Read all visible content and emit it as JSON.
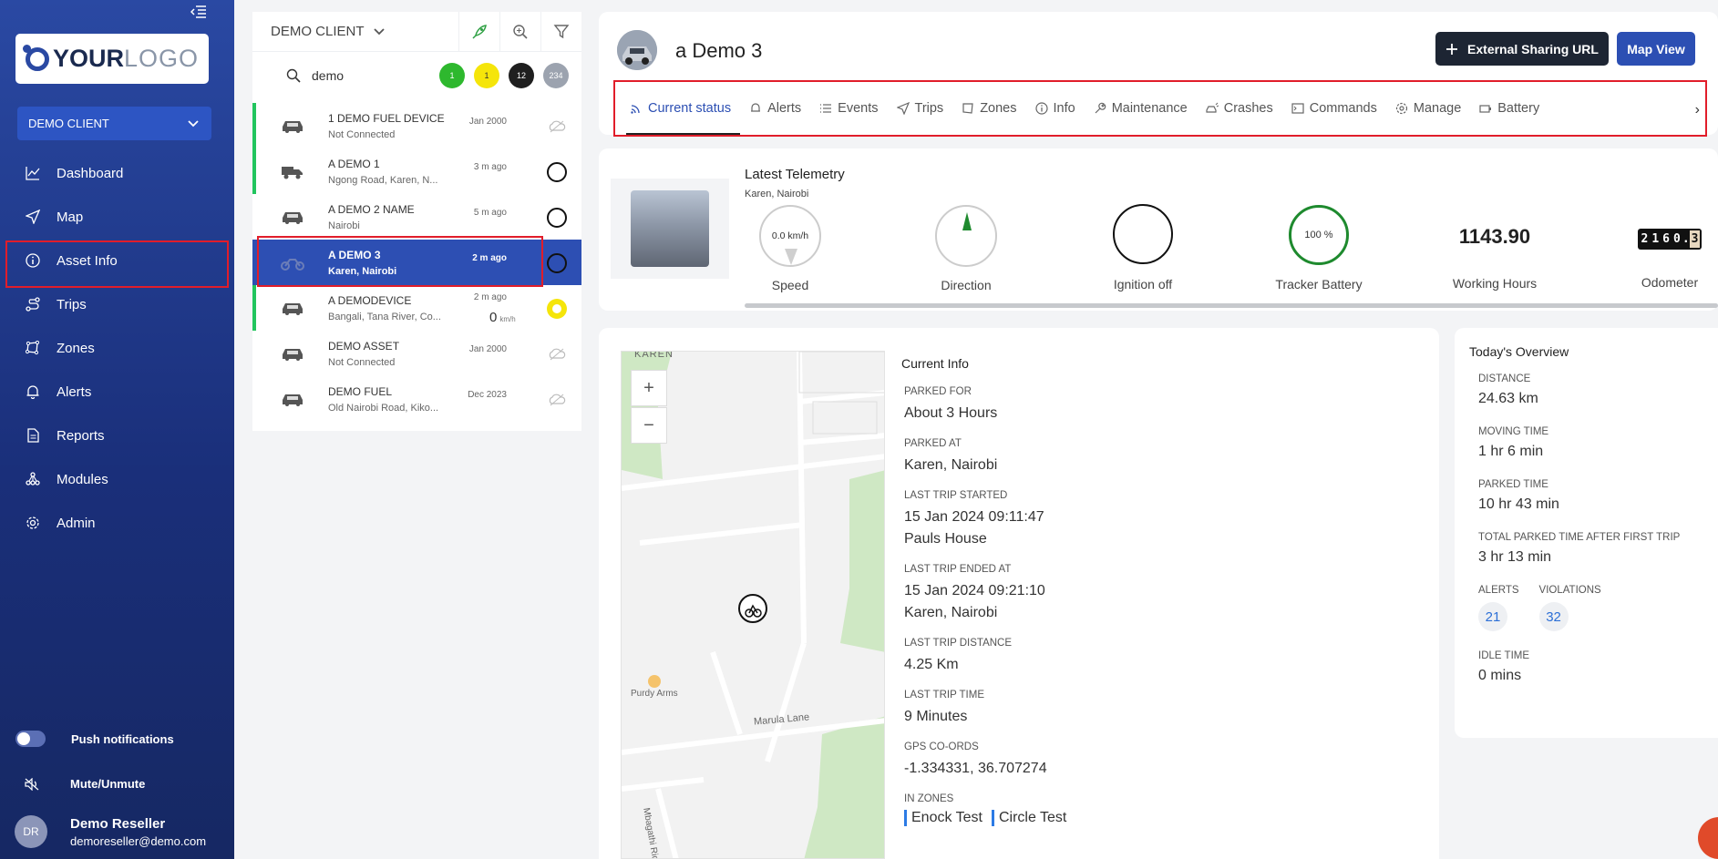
{
  "sidebar": {
    "logo_bold": "YOUR",
    "logo_light": "LOGO",
    "client_select": "DEMO CLIENT",
    "nav": [
      {
        "label": "Dashboard",
        "icon": "chart-line-icon"
      },
      {
        "label": "Map",
        "icon": "navigation-arrow-icon"
      },
      {
        "label": "Asset Info",
        "icon": "info-circle-icon"
      },
      {
        "label": "Trips",
        "icon": "route-icon"
      },
      {
        "label": "Zones",
        "icon": "zone-icon"
      },
      {
        "label": "Alerts",
        "icon": "bell-icon"
      },
      {
        "label": "Reports",
        "icon": "document-icon"
      },
      {
        "label": "Modules",
        "icon": "modules-icon"
      },
      {
        "label": "Admin",
        "icon": "gear-icon"
      }
    ],
    "push_label": "Push notifications",
    "mute_label": "Mute/Unmute",
    "user": {
      "initials": "DR",
      "name": "Demo Reseller",
      "email": "demoreseller@demo.com"
    }
  },
  "list": {
    "client": "DEMO CLIENT",
    "search_value": "demo",
    "counts": [
      {
        "value": "1",
        "color": "#2eb82e",
        "text_color": "#ffffff"
      },
      {
        "value": "1",
        "color": "#f5e50a",
        "text_color": "#333333"
      },
      {
        "value": "12",
        "color": "#1f1f1f",
        "text_color": "#ffffff"
      },
      {
        "value": "234",
        "color": "#9ca3af",
        "text_color": "#ffffff"
      }
    ],
    "assets": [
      {
        "name": "1 DEMO FUEL DEVICE",
        "sub": "Not Connected",
        "time": "Jan 2000",
        "status": "cloud"
      },
      {
        "name": "A DEMO 1",
        "sub": "Ngong Road, Karen, N...",
        "time": "3 m ago",
        "status": "parked"
      },
      {
        "name": "A DEMO 2 NAME",
        "sub": "Nairobi",
        "time": "5 m ago",
        "status": "parked"
      },
      {
        "name": "A DEMO 3",
        "sub": "Karen, Nairobi",
        "time": "2 m ago",
        "status": "parked"
      },
      {
        "name": "A DEMODEVICE",
        "sub": "Bangali, Tana River, Co...",
        "time": "2 m ago",
        "speed": "0",
        "speed_unit": "km/h",
        "status": "idle"
      },
      {
        "name": "DEMO ASSET",
        "sub": "Not Connected",
        "time": "Jan 2000",
        "status": "cloud"
      },
      {
        "name": "DEMO FUEL",
        "sub": "Old Nairobi Road, Kiko...",
        "time": "Dec 2023",
        "status": "cloud"
      }
    ]
  },
  "header": {
    "title": "a Demo 3",
    "external_btn": "External Sharing URL",
    "map_btn": "Map View",
    "tabs": [
      "Current status",
      "Alerts",
      "Events",
      "Trips",
      "Zones",
      "Info",
      "Maintenance",
      "Crashes",
      "Commands",
      "Manage",
      "Battery"
    ]
  },
  "telemetry": {
    "title": "Latest Telemetry",
    "location": "Karen, Nairobi",
    "speed": "0.0 km/h",
    "speed_label": "Speed",
    "direction_label": "Direction",
    "ignition_label": "Ignition off",
    "battery": "100 %",
    "battery_label": "Tracker Battery",
    "working_hours": "1143.90",
    "working_hours_label": "Working Hours",
    "odometer_digits": [
      "2",
      "1",
      "6",
      "0",
      ".",
      "3"
    ],
    "odometer_label": "Odometer"
  },
  "map": {
    "labels": {
      "karen": "KAREN",
      "purdy": "Purdy Arms",
      "marula": "Marula Lane",
      "mbagathi": "Mbagathi Ridge"
    },
    "zoom_in": "+",
    "zoom_out": "−"
  },
  "current_info": {
    "title": "Current Info",
    "parked_for_label": "PARKED FOR",
    "parked_for": "About 3 Hours",
    "parked_at_label": "PARKED AT",
    "parked_at": "Karen, Nairobi",
    "trip_started_label": "LAST TRIP STARTED",
    "trip_started": "15 Jan 2024 09:11:47",
    "trip_started_place": "Pauls House",
    "trip_ended_label": "LAST TRIP ENDED AT",
    "trip_ended": "15 Jan 2024 09:21:10",
    "trip_ended_place": "Karen, Nairobi",
    "trip_distance_label": "LAST TRIP DISTANCE",
    "trip_distance": "4.25 Km",
    "trip_time_label": "LAST TRIP TIME",
    "trip_time": "9 Minutes",
    "gps_label": "GPS CO-ORDS",
    "gps": "-1.334331, 36.707274",
    "zones_label": "IN ZONES",
    "zones": [
      "Enock Test",
      "Circle Test"
    ]
  },
  "overview": {
    "title": "Today's Overview",
    "distance_label": "DISTANCE",
    "distance": "24.63 km",
    "moving_label": "MOVING TIME",
    "moving": "1 hr 6 min",
    "parked_label": "PARKED TIME",
    "parked": "10 hr 43 min",
    "total_parked_label": "TOTAL PARKED TIME AFTER FIRST TRIP",
    "total_parked": "3 hr 13 min",
    "alerts_label": "ALERTS",
    "alerts": "21",
    "violations_label": "VIOLATIONS",
    "violations": "32",
    "idle_label": "IDLE TIME",
    "idle": "0 mins"
  }
}
